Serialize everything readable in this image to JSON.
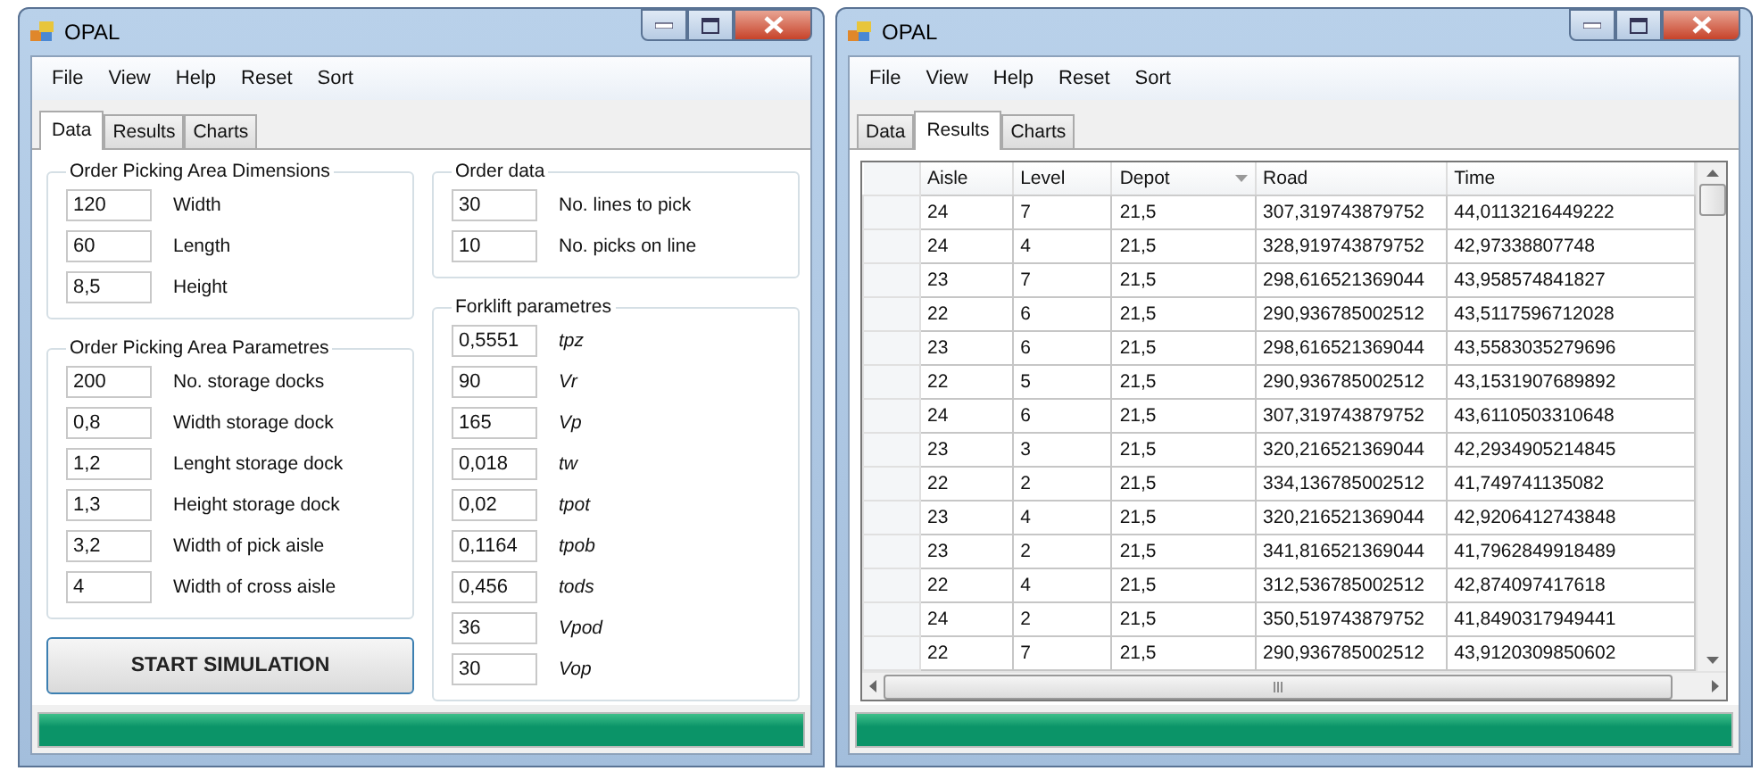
{
  "windows": [
    {
      "title": "OPAL",
      "menu": [
        "File",
        "View",
        "Help",
        "Reset",
        "Sort"
      ],
      "tabs": [
        {
          "label": "Data",
          "selected": true
        },
        {
          "label": "Results",
          "selected": false
        },
        {
          "label": "Charts",
          "selected": false
        }
      ],
      "kind": "data",
      "groups": [
        {
          "title": "Order Picking Area Dimensions",
          "italic": false,
          "fields": [
            {
              "value": "120",
              "label": "Width"
            },
            {
              "value": "60",
              "label": "Length"
            },
            {
              "value": "8,5",
              "label": "Height"
            }
          ]
        },
        {
          "title": "Order Picking Area Parametres",
          "italic": false,
          "fields": [
            {
              "value": "200",
              "label": "No. storage docks"
            },
            {
              "value": "0,8",
              "label": "Width storage dock"
            },
            {
              "value": "1,2",
              "label": "Lenght storage dock"
            },
            {
              "value": "1,3",
              "label": "Height storage dock"
            },
            {
              "value": "3,2",
              "label": "Width of pick aisle"
            },
            {
              "value": "4",
              "label": "Width of cross aisle"
            }
          ]
        },
        {
          "title": "Order data",
          "italic": false,
          "fields": [
            {
              "value": "30",
              "label": "No. lines to pick"
            },
            {
              "value": "10",
              "label": "No. picks on line"
            }
          ]
        },
        {
          "title": "Forklift parametres",
          "italic": true,
          "fields": [
            {
              "value": "0,5551",
              "label": "tpz"
            },
            {
              "value": "90",
              "label": "Vr"
            },
            {
              "value": "165",
              "label": "Vp"
            },
            {
              "value": "0,018",
              "label": "tw"
            },
            {
              "value": "0,02",
              "label": "tpot"
            },
            {
              "value": "0,1164",
              "label": "tpob"
            },
            {
              "value": "0,456",
              "label": "tods"
            },
            {
              "value": "36",
              "label": "Vpod"
            },
            {
              "value": "30",
              "label": "Vop"
            }
          ]
        }
      ],
      "button": "START SIMULATION",
      "progress": {
        "level": 1
      }
    },
    {
      "title": "OPAL",
      "menu": [
        "File",
        "View",
        "Help",
        "Reset",
        "Sort"
      ],
      "tabs": [
        {
          "label": "Data",
          "selected": false
        },
        {
          "label": "Results",
          "selected": true
        },
        {
          "label": "Charts",
          "selected": false
        }
      ],
      "kind": "results",
      "table": {
        "columns": [
          {
            "label": "Aisle",
            "sorted": false
          },
          {
            "label": "Level",
            "sorted": false
          },
          {
            "label": "Depot",
            "sorted": true
          },
          {
            "label": "Road",
            "sorted": false
          },
          {
            "label": "Time",
            "sorted": false
          }
        ],
        "rows": [
          [
            "24",
            "7",
            "21,5",
            "307,319743879752",
            "44,0113216449222"
          ],
          [
            "24",
            "4",
            "21,5",
            "328,919743879752",
            "42,97338807748"
          ],
          [
            "23",
            "7",
            "21,5",
            "298,616521369044",
            "43,958574841827"
          ],
          [
            "22",
            "6",
            "21,5",
            "290,936785002512",
            "43,5117596712028"
          ],
          [
            "23",
            "6",
            "21,5",
            "298,616521369044",
            "43,5583035279696"
          ],
          [
            "22",
            "5",
            "21,5",
            "290,936785002512",
            "43,1531907689892"
          ],
          [
            "24",
            "6",
            "21,5",
            "307,319743879752",
            "43,6110503310648"
          ],
          [
            "23",
            "3",
            "21,5",
            "320,216521369044",
            "42,2934905214845"
          ],
          [
            "22",
            "2",
            "21,5",
            "334,136785002512",
            "41,749741135082"
          ],
          [
            "23",
            "4",
            "21,5",
            "320,216521369044",
            "42,9206412743848"
          ],
          [
            "23",
            "2",
            "21,5",
            "341,816521369044",
            "41,7962849918489"
          ],
          [
            "22",
            "4",
            "21,5",
            "312,536785002512",
            "42,874097417618"
          ],
          [
            "24",
            "2",
            "21,5",
            "350,519743879752",
            "41,8490317949441"
          ],
          [
            "22",
            "7",
            "21,5",
            "290,936785002512",
            "43,9120309850602"
          ]
        ]
      },
      "progress": {
        "level": 1
      }
    }
  ]
}
